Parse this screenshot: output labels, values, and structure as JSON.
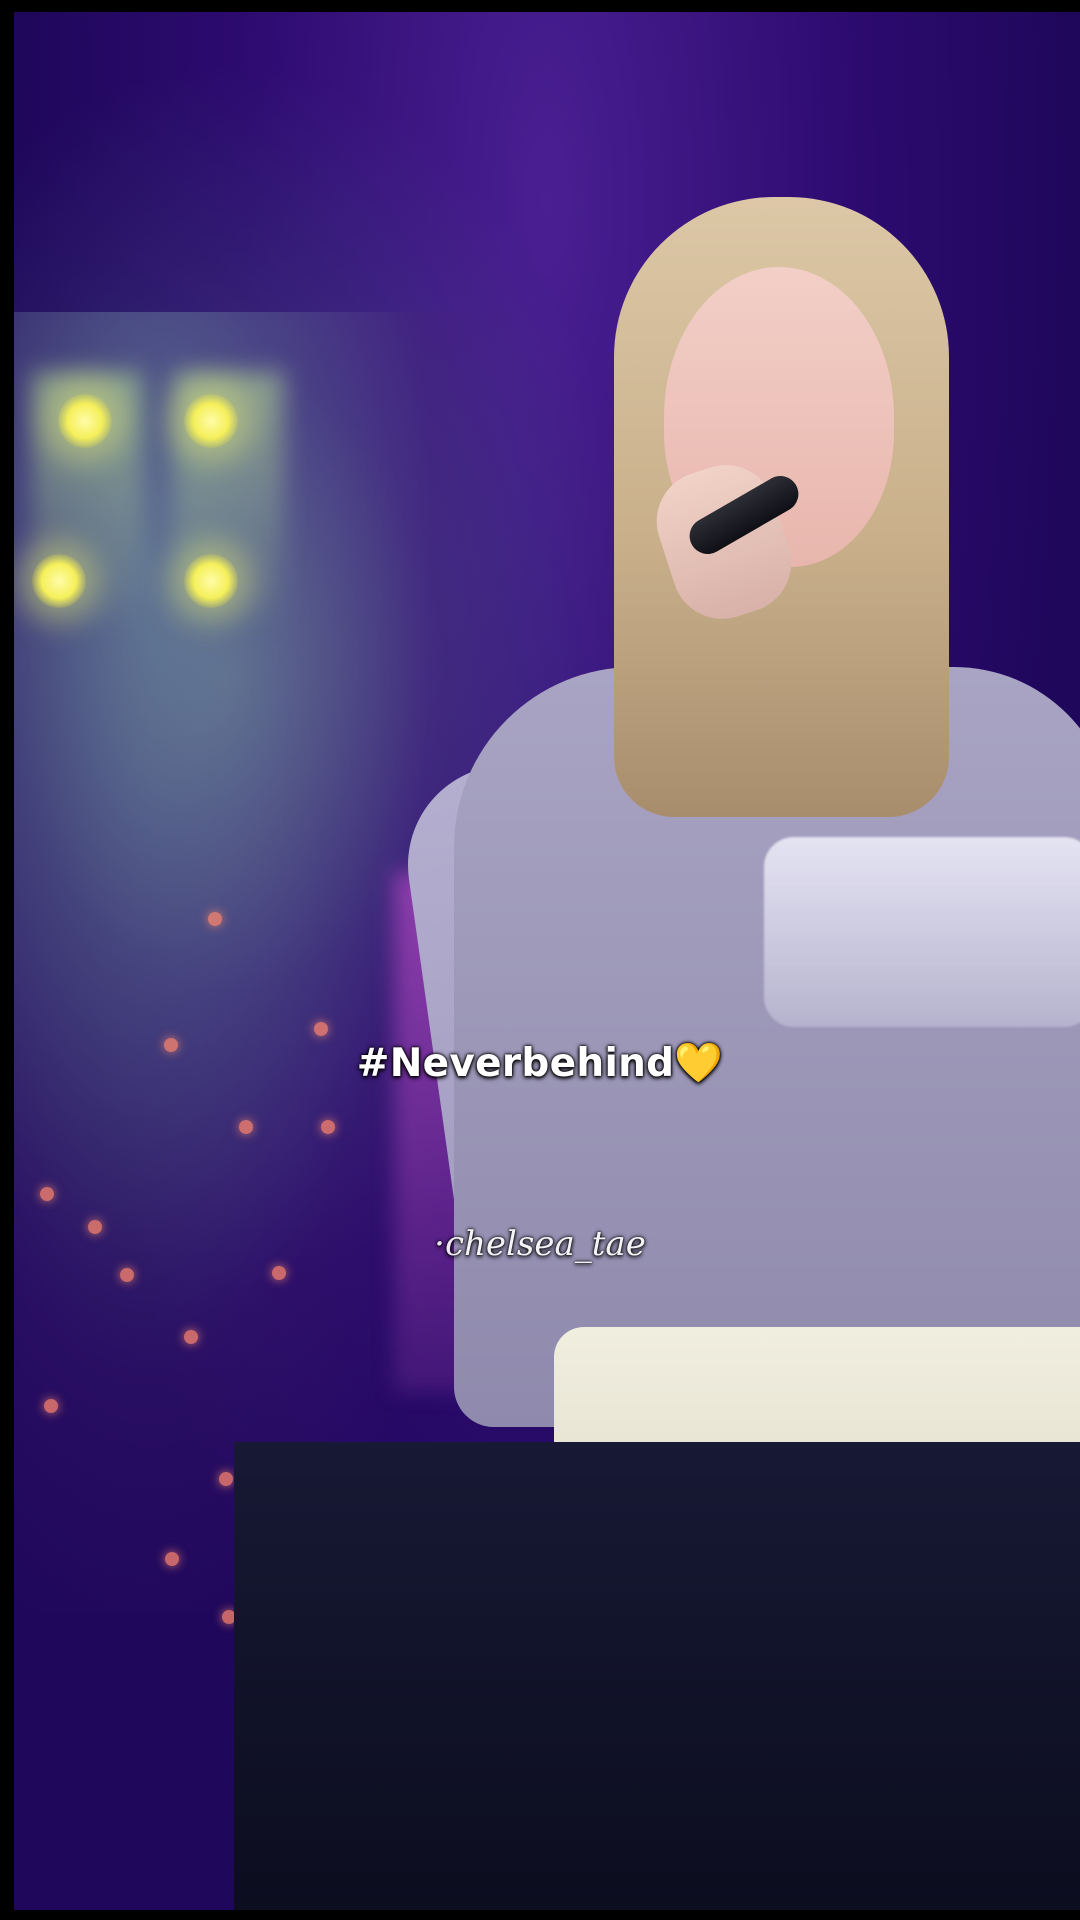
{
  "caption": {
    "hashtag": "#Neverbehind💛"
  },
  "watermark": {
    "text": "·chelsea_tae"
  }
}
